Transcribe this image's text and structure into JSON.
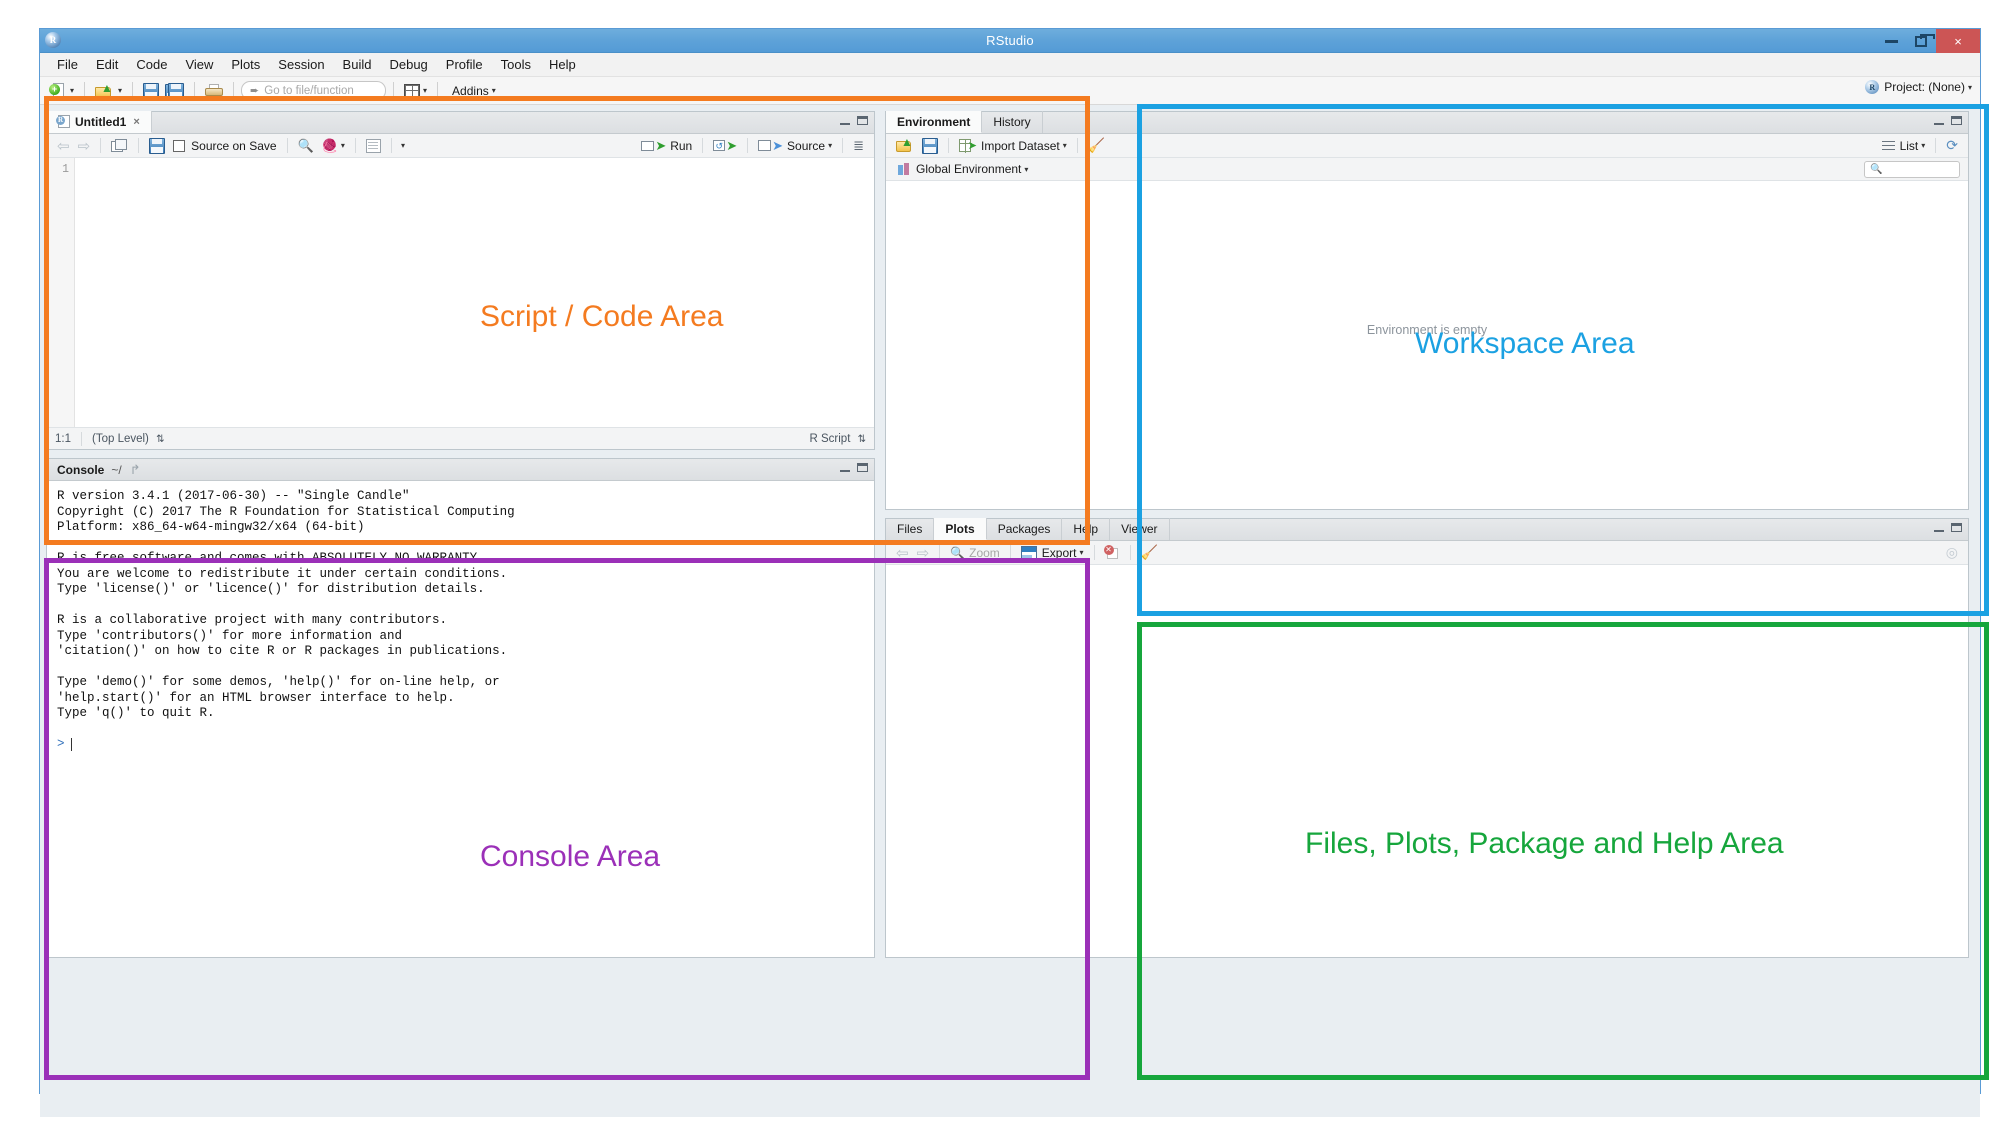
{
  "window": {
    "title": "RStudio",
    "logo_letter": "R",
    "controls": {
      "minimize": "minimize-button",
      "maximize": "maximize-button",
      "close": "×"
    }
  },
  "menubar": {
    "items": [
      {
        "label": "File"
      },
      {
        "label": "Edit"
      },
      {
        "label": "Code"
      },
      {
        "label": "View"
      },
      {
        "label": "Plots"
      },
      {
        "label": "Session"
      },
      {
        "label": "Build"
      },
      {
        "label": "Debug"
      },
      {
        "label": "Profile"
      },
      {
        "label": "Tools"
      },
      {
        "label": "Help"
      }
    ]
  },
  "toolbar": {
    "new_file": "new-file",
    "open_file": "open-file",
    "save": "save",
    "save_all": "save-all",
    "print": "print",
    "goto_placeholder": "Go to file/function",
    "panes": "workspace-panes",
    "addins_label": "Addins",
    "caret": "▾",
    "project_label": "Project: (None)",
    "project_logo": "R"
  },
  "editor": {
    "tab": {
      "label": "Untitled1",
      "close": "×"
    },
    "toolbar": {
      "back": "⇦",
      "forward": "⇨",
      "show_in_window": "show-in-new-window",
      "save": "save",
      "source_on_save_label": "Source on Save",
      "find": "find-replace",
      "code_tools": "code-tools",
      "compile_report": "compile-report",
      "more_caret": "▾",
      "run_label": "Run",
      "rerun": "re-run-previous",
      "source_label": "Source",
      "source_caret": "▾",
      "outline": "document-outline"
    },
    "line_numbers": [
      "1"
    ],
    "status": {
      "cursor": "1:1",
      "scope": "(Top Level)",
      "scope_stepper": "⇅",
      "file_type": "R Script",
      "type_stepper": "⇅"
    }
  },
  "console": {
    "title": "Console",
    "path": "~/",
    "popout_icon": "↱",
    "lines": [
      "R version 3.4.1 (2017-06-30) -- \"Single Candle\"",
      "Copyright (C) 2017 The R Foundation for Statistical Computing",
      "Platform: x86_64-w64-mingw32/x64 (64-bit)",
      "",
      "R is free software and comes with ABSOLUTELY NO WARRANTY.",
      "You are welcome to redistribute it under certain conditions.",
      "Type 'license()' or 'licence()' for distribution details.",
      "",
      "R is a collaborative project with many contributors.",
      "Type 'contributors()' for more information and",
      "'citation()' on how to cite R or R packages in publications.",
      "",
      "Type 'demo()' for some demos, 'help()' for on-line help, or",
      "'help.start()' for an HTML browser interface to help.",
      "Type 'q()' to quit R.",
      ""
    ],
    "prompt": ">"
  },
  "environment": {
    "tabs": [
      {
        "label": "Environment",
        "active": true
      },
      {
        "label": "History",
        "active": false
      }
    ],
    "toolbar": {
      "load_workspace": "load-workspace",
      "save_workspace": "save-workspace",
      "import_dataset_label": "Import Dataset",
      "import_caret": "▾",
      "clear_objects": "clear-objects-broom",
      "view_mode_label": "List",
      "view_mode_caret": "▾",
      "refresh": "⟳",
      "search_placeholder": ""
    },
    "scope_selector": {
      "label": "Global Environment",
      "caret": "▾"
    },
    "empty_message": "Environment is empty"
  },
  "filespanel": {
    "tabs": [
      {
        "label": "Files",
        "active": false
      },
      {
        "label": "Plots",
        "active": true
      },
      {
        "label": "Packages",
        "active": false
      },
      {
        "label": "Help",
        "active": false
      },
      {
        "label": "Viewer",
        "active": false
      }
    ],
    "toolbar": {
      "back": "⇦",
      "forward": "⇨",
      "zoom_label": "Zoom",
      "export_label": "Export",
      "export_caret": "▾",
      "remove_plot": "remove-current-plot",
      "clear_plots": "clear-all-plots-broom"
    }
  },
  "annotations": {
    "script": {
      "label": "Script / Code Area",
      "color": "#F47B20"
    },
    "workspace": {
      "label": "Workspace Area",
      "color": "#1BA1E2"
    },
    "console": {
      "label": "Console Area",
      "color": "#9B30B8"
    },
    "files": {
      "label": "Files, Plots, Package and Help Area",
      "color": "#16A63C"
    }
  }
}
